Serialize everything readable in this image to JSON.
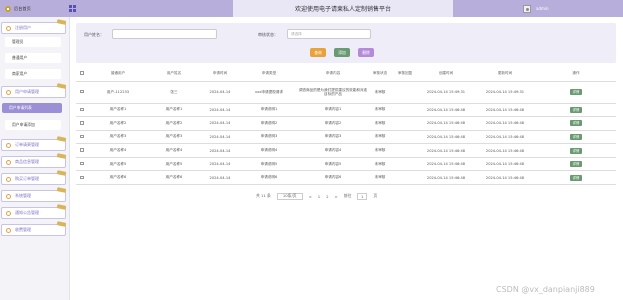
{
  "header": {
    "logo_text": "后台首页",
    "site_title": "欢迎使用电子请柬私人定制销售平台",
    "username": "admin"
  },
  "sidebar": {
    "groups": [
      {
        "label": "注册用户",
        "expanded": true,
        "subitems": [
          "管理员",
          "普通用户",
          "商家用户"
        ]
      },
      {
        "label": "用户申请管理",
        "expanded": true,
        "subitems": [
          "用户申请列表",
          "用户申请添加"
        ]
      },
      {
        "label": "订单请柬管理"
      },
      {
        "label": "商品信息管理"
      },
      {
        "label": "购买订单管理"
      },
      {
        "label": "系统管理"
      },
      {
        "label": "通知公告管理"
      },
      {
        "label": "收费管理"
      }
    ]
  },
  "search": {
    "user_label": "用户姓名：",
    "user_value": "",
    "status_label": "审核状态：",
    "status_placeholder": "请选择",
    "query_btn": "查询",
    "add_btn": "添加",
    "delete_btn": "删除"
  },
  "colors": {
    "accent": "#9b8fd6",
    "query": "#e8a23c",
    "add": "#6a9a72",
    "delete": "#b58ad9"
  },
  "table": {
    "headers": [
      "",
      "普通用户",
      "用户姓名",
      "申请时间",
      "申请类型",
      "申请内容",
      "审核状态",
      "审核回复",
      "创建时间",
      "更新时间",
      "操作"
    ],
    "rows": [
      [
        "",
        "用户-112233",
        "张三",
        "2024-04-14",
        "xxx申请提现请求",
        "调查商品的是为我们提供建议的效能和对准目标的产品",
        "未审核",
        "",
        "2024-04-14 15:49:31",
        "2024-04-14 15:49:31",
        "详情"
      ],
      [
        "",
        "用户名称1",
        "用户名称1",
        "2024-04-14",
        "申请说明1",
        "申请内容1",
        "未审核",
        "",
        "2024-04-14 15:46:48",
        "2024-04-14 15:46:48",
        "详情"
      ],
      [
        "",
        "用户名称2",
        "用户名称2",
        "2024-04-14",
        "申请说明2",
        "申请内容2",
        "未审核",
        "",
        "2024-04-14 15:46:48",
        "2024-04-14 15:46:48",
        "详情"
      ],
      [
        "",
        "用户名称3",
        "用户名称3",
        "2024-04-14",
        "申请说明3",
        "申请内容3",
        "未审核",
        "",
        "2024-04-14 15:46:48",
        "2024-04-14 15:46:48",
        "详情"
      ],
      [
        "",
        "用户名称4",
        "用户名称4",
        "2024-04-14",
        "申请说明4",
        "申请内容4",
        "未审核",
        "",
        "2024-04-14 15:46:48",
        "2024-04-14 15:46:48",
        "详情"
      ],
      [
        "",
        "用户名称5",
        "用户名称5",
        "2024-04-14",
        "申请说明5",
        "申请内容5",
        "未审核",
        "",
        "2024-04-14 15:46:48",
        "2024-04-14 15:46:48",
        "详情"
      ],
      [
        "",
        "用户名称6",
        "用户名称6",
        "2024-04-14",
        "申请说明6",
        "申请内容6",
        "未审核",
        "",
        "2024-04-14 15:46:48",
        "2024-04-14 15:46:48",
        "详情"
      ]
    ]
  },
  "pagination": {
    "total": "共 11 条",
    "page_size": "10条/页",
    "prev": "<",
    "pages": [
      "1",
      "2"
    ],
    "next": ">",
    "goto_label": "前往",
    "goto_value": "1",
    "goto_unit": "页"
  },
  "watermark": "CSDN @vx_danpianji889"
}
